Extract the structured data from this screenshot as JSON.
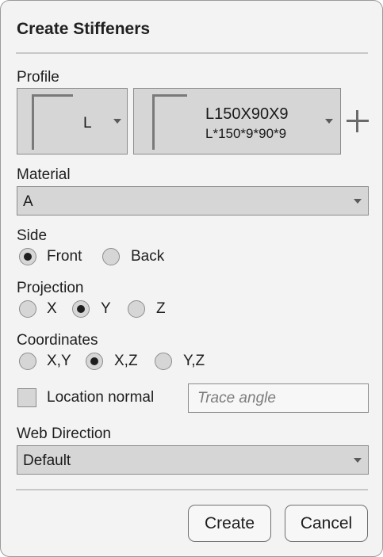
{
  "dialog": {
    "title": "Create Stiffeners"
  },
  "profile": {
    "label": "Profile",
    "type_value": "L",
    "name": "L150X90X9",
    "description": "L*150*9*90*9",
    "add_icon": "plus-icon"
  },
  "material": {
    "label": "Material",
    "value": "A"
  },
  "side": {
    "label": "Side",
    "options": [
      {
        "label": "Front",
        "selected": true
      },
      {
        "label": "Back",
        "selected": false
      }
    ]
  },
  "projection": {
    "label": "Projection",
    "options": [
      {
        "label": "X",
        "selected": false
      },
      {
        "label": "Y",
        "selected": true
      },
      {
        "label": "Z",
        "selected": false
      }
    ]
  },
  "coordinates": {
    "label": "Coordinates",
    "options": [
      {
        "label": "X,Y",
        "selected": false
      },
      {
        "label": "X,Z",
        "selected": true
      },
      {
        "label": "Y,Z",
        "selected": false
      }
    ]
  },
  "location_normal": {
    "label": "Location normal",
    "checked": false
  },
  "trace_angle": {
    "placeholder": "Trace angle",
    "value": ""
  },
  "web_direction": {
    "label": "Web Direction",
    "value": "Default"
  },
  "buttons": {
    "create": "Create",
    "cancel": "Cancel"
  },
  "colors": {
    "dialog_bg": "#f3f3f3",
    "field_bg": "#d6d6d6",
    "border": "#8c8c8c"
  }
}
